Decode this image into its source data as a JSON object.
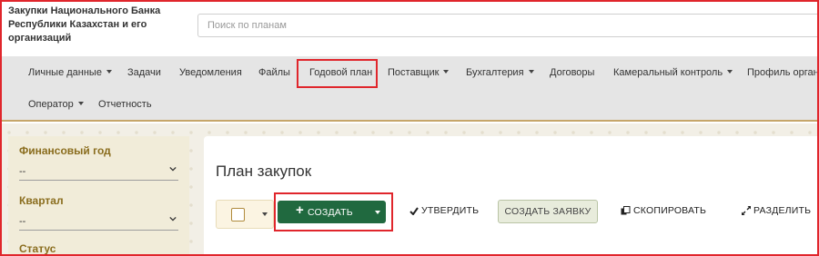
{
  "header": {
    "org_name": "Закупки Национального Банка Республики Казахстан и его организаций",
    "search_placeholder": "Поиск по планам"
  },
  "nav": {
    "items": [
      {
        "label": "Личные данные",
        "dropdown": true
      },
      {
        "label": "Задачи",
        "dropdown": false
      },
      {
        "label": "Уведомления",
        "dropdown": false
      },
      {
        "label": "Файлы",
        "dropdown": false
      },
      {
        "label": "Годовой план",
        "dropdown": false,
        "highlighted": true
      },
      {
        "label": "Поставщик",
        "dropdown": true
      },
      {
        "label": "Бухгалтерия",
        "dropdown": true
      },
      {
        "label": "Договоры",
        "dropdown": false
      },
      {
        "label": "Камеральный контроль",
        "dropdown": true
      },
      {
        "label": "Профиль органи",
        "dropdown": false
      },
      {
        "label": "Оператор",
        "dropdown": true
      },
      {
        "label": "Отчетность",
        "dropdown": false
      }
    ]
  },
  "sidebar": {
    "fields": [
      {
        "label": "Финансовый год",
        "value": "--"
      },
      {
        "label": "Квартал",
        "value": "--"
      },
      {
        "label": "Статус",
        "value": ""
      }
    ]
  },
  "main": {
    "title": "План закупок",
    "toolbar": {
      "create_label": "СОЗДАТЬ",
      "approve_label": "УТВЕРДИТЬ",
      "create_request_label": "СОЗДАТЬ ЗАЯВКУ",
      "copy_label": "СКОПИРОВАТЬ",
      "split_label": "РАЗДЕЛИТЬ"
    }
  },
  "colors": {
    "highlight": "#e0262c",
    "primary_button": "#20693f",
    "sidebar_label": "#8a6d1e",
    "nav_background": "#e5e5e5",
    "nav_border": "#c6a66a"
  }
}
